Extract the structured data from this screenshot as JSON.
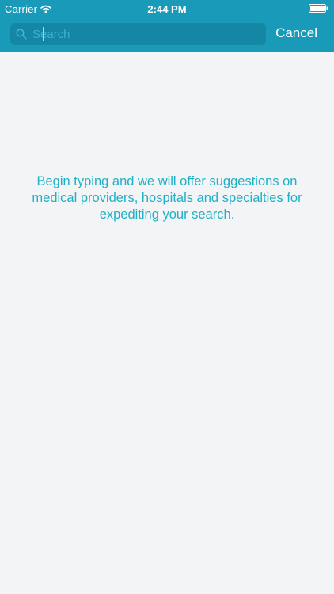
{
  "status_bar": {
    "carrier": "Carrier",
    "time": "2:44 PM"
  },
  "search": {
    "placeholder": "Search",
    "value": "",
    "cancel_label": "Cancel"
  },
  "empty_state": {
    "message": "Begin typing and we will offer suggestions on medical providers, hospitals and specialties for expediting your search."
  },
  "icons": {
    "wifi": "wifi-icon",
    "battery": "battery-icon",
    "search": "search-icon"
  },
  "colors": {
    "header": "#1a9ab9",
    "search_field": "#1487a5",
    "accent_text": "#1fb0c6",
    "background": "#f3f4f6"
  }
}
